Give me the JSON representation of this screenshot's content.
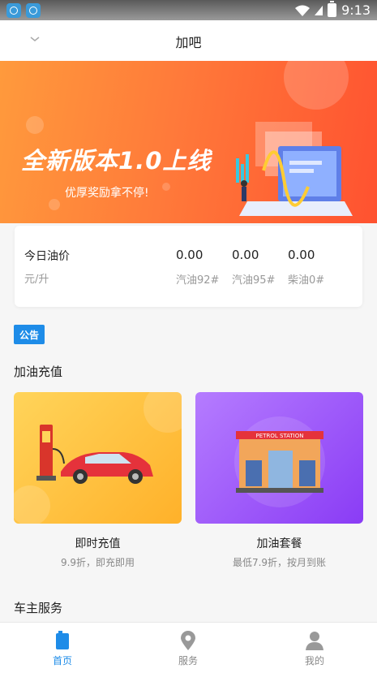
{
  "status_bar": {
    "time": "9:13"
  },
  "header": {
    "title": "加吧"
  },
  "banner": {
    "headline": "全新版本1.0上线",
    "subtitle": "优厚奖励拿不停!"
  },
  "price_card": {
    "title": "今日油价",
    "unit": "元/升",
    "prices": [
      {
        "value": "0.00",
        "label": "汽油92#"
      },
      {
        "value": "0.00",
        "label": "汽油95#"
      },
      {
        "value": "0.00",
        "label": "柴油0#"
      }
    ]
  },
  "notice": {
    "badge": "公告"
  },
  "sections": {
    "recharge": "加油充值",
    "owner_services": "车主服务"
  },
  "services": [
    {
      "name": "即时充值",
      "desc": "9.9折，即充即用"
    },
    {
      "name": "加油套餐",
      "desc": "最低7.9折，按月到账"
    }
  ],
  "station_sign": "PETROL STATION",
  "tabs": [
    {
      "label": "首页",
      "icon": "home-icon"
    },
    {
      "label": "服务",
      "icon": "location-pin-icon"
    },
    {
      "label": "我的",
      "icon": "user-icon"
    }
  ],
  "colors": {
    "accent": "#1e8ce8",
    "banner": "#ff6a34"
  }
}
